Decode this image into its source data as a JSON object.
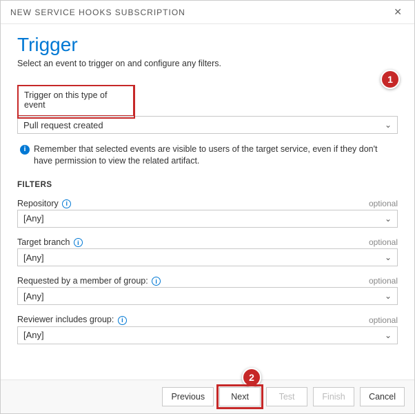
{
  "header": {
    "title": "NEW SERVICE HOOKS SUBSCRIPTION"
  },
  "page": {
    "title": "Trigger",
    "subtitle": "Select an event to trigger on and configure any filters."
  },
  "trigger": {
    "label": "Trigger on this type of event",
    "value": "Pull request created"
  },
  "info_text": "Remember that selected events are visible to users of the target service, even if they don't have permission to view the related artifact.",
  "filters_heading": "FILTERS",
  "optional_label": "optional",
  "filters": {
    "repository": {
      "label": "Repository",
      "value": "[Any]"
    },
    "target_branch": {
      "label": "Target branch",
      "value": "[Any]"
    },
    "requested_by": {
      "label": "Requested by a member of group:",
      "value": "[Any]"
    },
    "reviewer": {
      "label": "Reviewer includes group:",
      "value": "[Any]"
    }
  },
  "callouts": {
    "one": "1",
    "two": "2"
  },
  "buttons": {
    "previous": "Previous",
    "next": "Next",
    "test": "Test",
    "finish": "Finish",
    "cancel": "Cancel"
  }
}
